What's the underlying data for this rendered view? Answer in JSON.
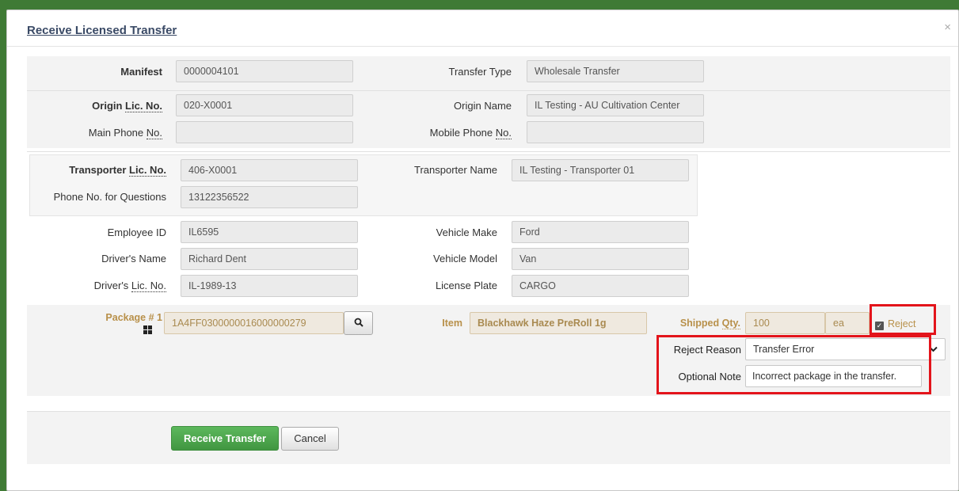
{
  "dialog": {
    "title": "Receive Licensed Transfer",
    "close_icon": "×"
  },
  "manifest": {
    "label": "Manifest",
    "value": "0000004101"
  },
  "transfer_type": {
    "label": "Transfer Type",
    "value": "Wholesale Transfer"
  },
  "origin": {
    "lic_label_prefix": "Origin ",
    "lic_label_abbr": "Lic. No.",
    "lic_value": "020-X0001",
    "name_label": "Origin Name",
    "name_value": "IL Testing - AU Cultivation Center",
    "main_phone_label_prefix": "Main Phone ",
    "main_phone_label_abbr": "No.",
    "main_phone_value": "",
    "mobile_phone_label_prefix": "Mobile Phone ",
    "mobile_phone_label_abbr": "No.",
    "mobile_phone_value": ""
  },
  "transporter": {
    "lic_label_prefix": "Transporter ",
    "lic_label_abbr": "Lic. No.",
    "lic_value": "406-X0001",
    "name_label": "Transporter Name",
    "name_value": "IL Testing - Transporter 01",
    "phone_label": "Phone No. for Questions",
    "phone_value": "13122356522"
  },
  "driver": {
    "employee_id_label": "Employee ID",
    "employee_id_value": "IL6595",
    "name_label": "Driver's Name",
    "name_value": "Richard Dent",
    "lic_label_prefix": "Driver's ",
    "lic_label_abbr": "Lic. No.",
    "lic_value": "IL-1989-13"
  },
  "vehicle": {
    "make_label": "Vehicle Make",
    "make_value": "Ford",
    "model_label": "Vehicle Model",
    "model_value": "Van",
    "plate_label": "License Plate",
    "plate_value": "CARGO"
  },
  "package": {
    "label": "Package # 1",
    "value": "1A4FF0300000016000000279",
    "item_label": "Item",
    "item_value": "Blackhawk Haze PreRoll 1g",
    "shipped_qty_label_prefix": "Shipped ",
    "shipped_qty_label_abbr": "Qty.",
    "shipped_qty_value": "100",
    "unit": "ea",
    "reject_label": "Reject",
    "reject_checked": true,
    "reject_reason_label": "Reject Reason",
    "reject_reason_value": "Transfer Error",
    "optional_note_label": "Optional Note",
    "optional_note_value": "Incorrect package in the transfer."
  },
  "buttons": {
    "receive": "Receive Transfer",
    "cancel": "Cancel"
  },
  "colors": {
    "backdrop": "#3f7a35",
    "highlight": "#e3141b",
    "primary_button": "#5cb85c",
    "package_text": "#b8904a"
  }
}
